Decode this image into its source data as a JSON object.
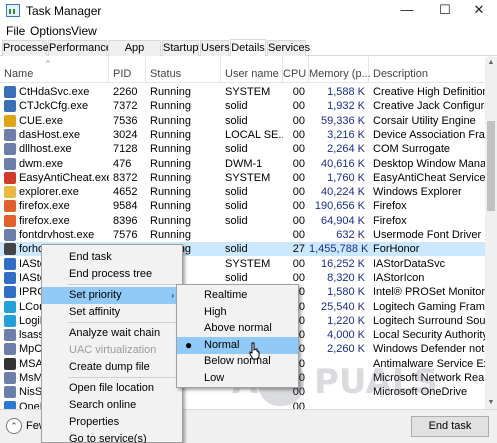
{
  "window": {
    "title": "Task Manager",
    "controls": [
      "—",
      "☐",
      "✕"
    ]
  },
  "menu": [
    "File",
    "Options",
    "View"
  ],
  "tabs": [
    "Processes",
    "Performance",
    "App history",
    "Startup",
    "Users",
    "Details",
    "Services"
  ],
  "active_tab": "Details",
  "columns": [
    "Name",
    "PID",
    "Status",
    "User name",
    "CPU",
    "Memory (p...",
    "Description"
  ],
  "rows": [
    {
      "name": "CtHdaSvc.exe",
      "pid": "2260",
      "status": "Running",
      "user": "SYSTEM",
      "cpu": "00",
      "mem": "1,588 K",
      "desc": "Creative High Definition...",
      "icon_color": "#3b6fb5"
    },
    {
      "name": "CTJckCfg.exe",
      "pid": "7372",
      "status": "Running",
      "user": "solid",
      "cpu": "00",
      "mem": "1,932 K",
      "desc": "Creative Jack Configurat...",
      "icon_color": "#3b6fb5"
    },
    {
      "name": "CUE.exe",
      "pid": "7536",
      "status": "Running",
      "user": "solid",
      "cpu": "00",
      "mem": "59,336 K",
      "desc": "Corsair Utility Engine",
      "icon_color": "#e0a418"
    },
    {
      "name": "dasHost.exe",
      "pid": "3024",
      "status": "Running",
      "user": "LOCAL SE...",
      "cpu": "00",
      "mem": "3,216 K",
      "desc": "Device Association Fra...",
      "icon_color": "#6d7fa8"
    },
    {
      "name": "dllhost.exe",
      "pid": "7128",
      "status": "Running",
      "user": "solid",
      "cpu": "00",
      "mem": "2,264 K",
      "desc": "COM Surrogate",
      "icon_color": "#6d7fa8"
    },
    {
      "name": "dwm.exe",
      "pid": "476",
      "status": "Running",
      "user": "DWM-1",
      "cpu": "00",
      "mem": "40,616 K",
      "desc": "Desktop Window Manag...",
      "icon_color": "#6d7fa8"
    },
    {
      "name": "EasyAntiCheat.exe",
      "pid": "8372",
      "status": "Running",
      "user": "SYSTEM",
      "cpu": "00",
      "mem": "1,760 K",
      "desc": "EasyAntiCheat Service",
      "icon_color": "#d23a2a"
    },
    {
      "name": "explorer.exe",
      "pid": "4652",
      "status": "Running",
      "user": "solid",
      "cpu": "00",
      "mem": "40,224 K",
      "desc": "Windows Explorer",
      "icon_color": "#e8b840"
    },
    {
      "name": "firefox.exe",
      "pid": "9584",
      "status": "Running",
      "user": "solid",
      "cpu": "00",
      "mem": "190,656 K",
      "desc": "Firefox",
      "icon_color": "#e2602a"
    },
    {
      "name": "firefox.exe",
      "pid": "8396",
      "status": "Running",
      "user": "solid",
      "cpu": "00",
      "mem": "64,904 K",
      "desc": "Firefox",
      "icon_color": "#e2602a"
    },
    {
      "name": "fontdrvhost.exe",
      "pid": "7576",
      "status": "Running",
      "user": "",
      "cpu": "00",
      "mem": "632 K",
      "desc": "Usermode Font Driver H...",
      "icon_color": "#6d7fa8"
    },
    {
      "name": "forhonor.exe",
      "pid": "2600",
      "status": "Running",
      "user": "solid",
      "cpu": "27",
      "mem": "1,455,788 K",
      "desc": "ForHonor",
      "icon_color": "#444444"
    },
    {
      "name": "IAStorDataMgrSvc.exe",
      "pid": "",
      "status": "",
      "user": "SYSTEM",
      "cpu": "00",
      "mem": "16,252 K",
      "desc": "IAStorDataSvc",
      "icon_color": "#2f6ec4"
    },
    {
      "name": "IAStorIcon.exe",
      "pid": "",
      "status": "",
      "user": "solid",
      "cpu": "00",
      "mem": "8,320 K",
      "desc": "IAStorIcon",
      "icon_color": "#2f6ec4"
    },
    {
      "name": "IPROSetMonitor.exe",
      "pid": "",
      "status": "",
      "user": "",
      "cpu": "00",
      "mem": "1,580 K",
      "desc": "Intel® PROSet Monitori...",
      "icon_color": "#2f6ec4"
    },
    {
      "name": "LCore.exe",
      "pid": "",
      "status": "",
      "user": "",
      "cpu": "00",
      "mem": "25,540 K",
      "desc": "Logitech Gaming Frame...",
      "icon_color": "#22a0d8"
    },
    {
      "name": "LogiRegistryService.exe",
      "pid": "",
      "status": "",
      "user": "",
      "cpu": "00",
      "mem": "1,220 K",
      "desc": "Logitech Surround Soun...",
      "icon_color": "#22a0d8"
    },
    {
      "name": "lsass.exe",
      "pid": "",
      "status": "",
      "user": "",
      "cpu": "00",
      "mem": "4,000 K",
      "desc": "Local Security Authority...",
      "icon_color": "#6d7fa8"
    },
    {
      "name": "MpCmdRun.exe",
      "pid": "",
      "status": "",
      "user": "",
      "cpu": "00",
      "mem": "2,260 K",
      "desc": "Windows Defender notif...",
      "icon_color": "#6d7fa8"
    },
    {
      "name": "MSASCuiL.exe",
      "pid": "",
      "status": "",
      "user": "",
      "cpu": "00",
      "mem": "",
      "desc": "Antimalware Service Exe...",
      "icon_color": "#333333"
    },
    {
      "name": "MsMpEng.exe",
      "pid": "",
      "status": "",
      "user": "",
      "cpu": "00",
      "mem": "",
      "desc": "Microsoft Network Realt...",
      "icon_color": "#6d7fa8"
    },
    {
      "name": "NisSrv.exe",
      "pid": "",
      "status": "",
      "user": "",
      "cpu": "00",
      "mem": "",
      "desc": "Microsoft OneDrive",
      "icon_color": "#6d7fa8"
    },
    {
      "name": "OneDrive.exe",
      "pid": "",
      "status": "",
      "user": "",
      "cpu": "00",
      "mem": "",
      "desc": "",
      "icon_color": "#2a7ad4"
    }
  ],
  "context_menu": {
    "items": [
      "End task",
      "End process tree",
      "Set priority",
      "Set affinity",
      "Analyze wait chain",
      "UAC virtualization",
      "Create dump file",
      "Open file location",
      "Search online",
      "Properties",
      "Go to service(s)"
    ],
    "highlighted": "Set priority",
    "disabled": [
      "UAC virtualization"
    ],
    "submenu_arrow": "›"
  },
  "priority_submenu": {
    "items": [
      "Realtime",
      "High",
      "Above normal",
      "Normal",
      "Below normal",
      "Low"
    ],
    "selected": "Normal",
    "bullet": "●"
  },
  "footer": {
    "fewer_details": "Fewer details",
    "end_task": "End task",
    "fewer_glyph": "⌃"
  },
  "colors": {
    "selection": "#cce8ff",
    "menu_highlight": "#91c9f7",
    "tab_active": "#ffffff"
  }
}
